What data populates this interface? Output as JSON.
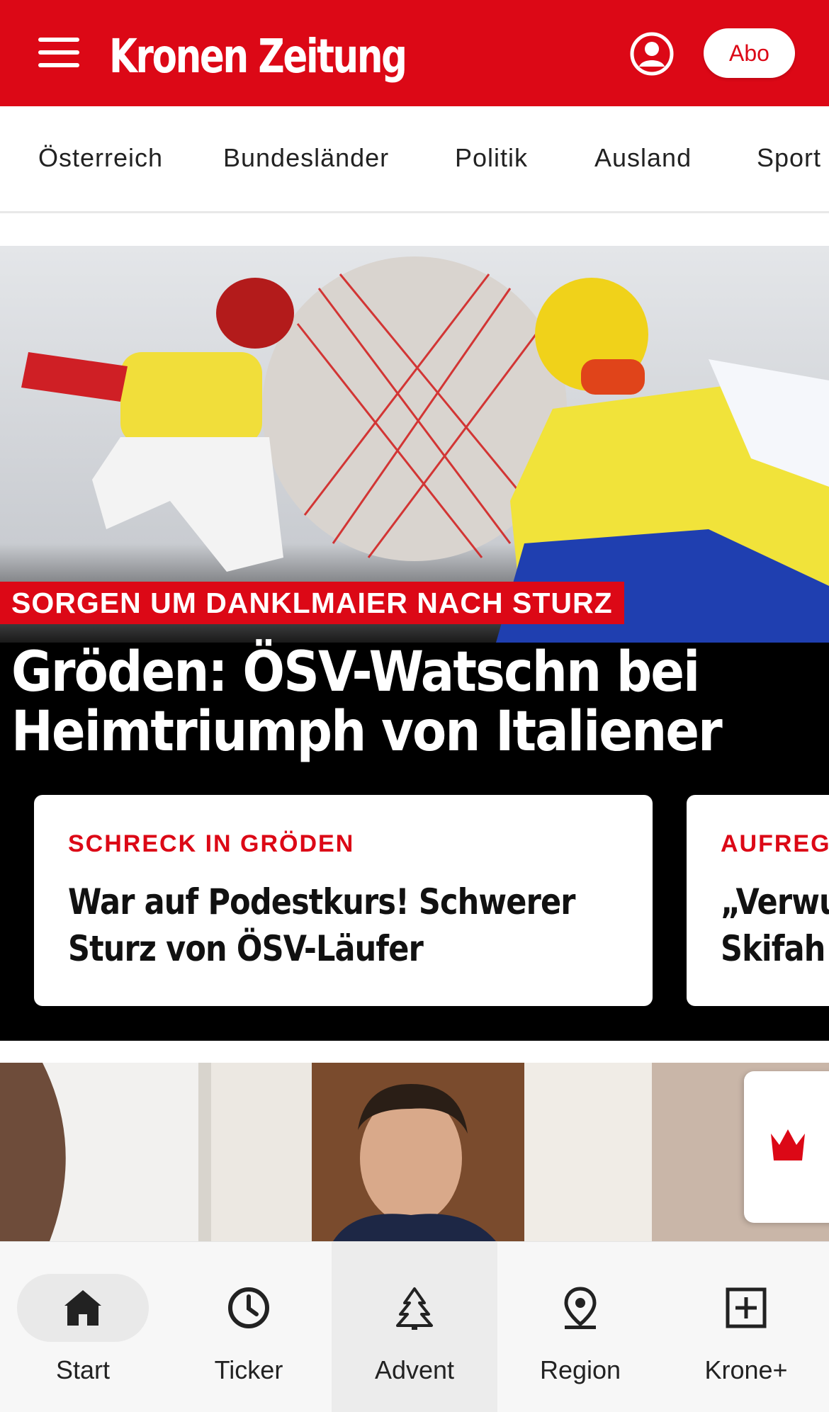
{
  "header": {
    "brand": "Kronen Zeitung",
    "abo_label": "Abo",
    "colors": {
      "brand_red": "#dc0816"
    }
  },
  "categories": [
    "Österreich",
    "Bundesländer",
    "Politik",
    "Ausland",
    "Sport"
  ],
  "hero": {
    "kicker": "SORGEN UM DANKLMAIER NACH STURZ",
    "headline_line1": "Gröden: ÖSV-Watschn bei",
    "headline_line2": "Heimtriumph von Italiener"
  },
  "cards": [
    {
      "kicker": "SCHRECK IN GRÖDEN",
      "title_line1": "War auf Podestkurs! Schwerer",
      "title_line2": "Sturz von ÖSV-Läufer"
    },
    {
      "kicker": "AUFREGU",
      "title_line1": "„Verwu",
      "title_line2": "Skifah"
    }
  ],
  "bottom_nav": [
    {
      "label": "Start",
      "icon": "home-icon"
    },
    {
      "label": "Ticker",
      "icon": "clock-icon"
    },
    {
      "label": "Advent",
      "icon": "tree-icon"
    },
    {
      "label": "Region",
      "icon": "location-pin-icon"
    },
    {
      "label": "Krone+",
      "icon": "plus-box-icon"
    }
  ]
}
